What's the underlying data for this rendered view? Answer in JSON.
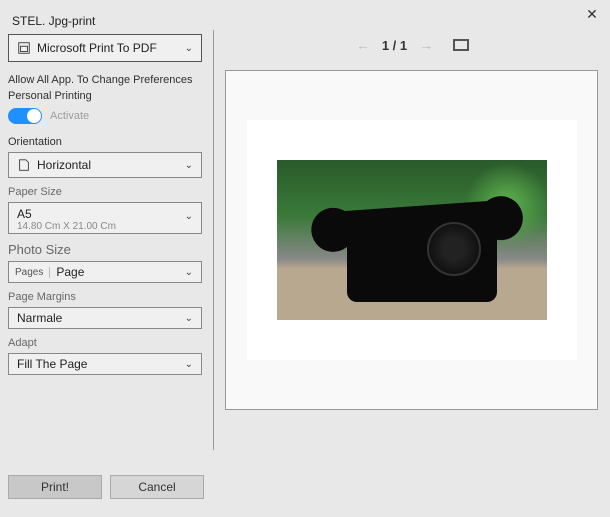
{
  "window": {
    "title": "STEL. Jpg-print"
  },
  "printer": {
    "selected": "Microsoft Print To PDF"
  },
  "permissions": {
    "label_line1": "Allow All App. To Change Preferences",
    "label_line2": "Personal Printing",
    "toggle_label": "Activate"
  },
  "orientation": {
    "label": "Orientation",
    "selected": "Horizontal"
  },
  "paper_size": {
    "label": "Paper Size",
    "selected": "A5",
    "dimensions": "14.80 Cm X 21.00 Cm"
  },
  "photo_size": {
    "label": "Photo Size",
    "prefix": "Pages",
    "selected": "Page"
  },
  "page_margins": {
    "label": "Page Margins",
    "selected": "Narmale"
  },
  "adapt": {
    "label": "Adapt",
    "selected": "Fill The Page"
  },
  "nav": {
    "page_indicator": "1 / 1"
  },
  "buttons": {
    "print": "Print!",
    "cancel": "Cancel"
  }
}
